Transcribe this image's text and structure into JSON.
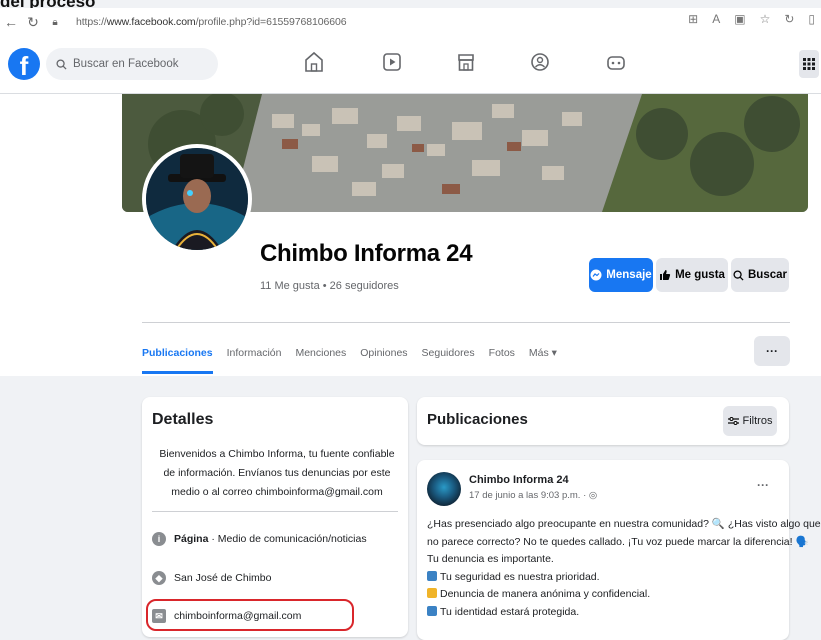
{
  "caption": "del proceso",
  "browser": {
    "url_prefix": "https://",
    "url_domain": "www.facebook.com",
    "url_path": "/profile.php?id=61559768106606"
  },
  "fb": {
    "search_placeholder": "Buscar en Facebook"
  },
  "profile": {
    "name": "Chimbo Informa 24",
    "stats": "11 Me gusta • 26 seguidores",
    "buttons": {
      "message": "Mensaje",
      "like": "Me gusta",
      "search": "Buscar"
    },
    "tabs": [
      "Publicaciones",
      "Información",
      "Menciones",
      "Opiniones",
      "Seguidores",
      "Fotos",
      "Más ▾"
    ],
    "more": "···"
  },
  "details": {
    "title": "Detalles",
    "bio": "Bienvenidos a Chimbo Informa, tu fuente confiable de información. Envíanos tus denuncias por este medio o al correo chimboinforma@gmail.com",
    "category_label": "Página",
    "category_value": " · Medio de comunicación/noticias",
    "location": "San José de Chimbo",
    "email": "chimboinforma@gmail.com"
  },
  "publications": {
    "title": "Publicaciones",
    "filters": "Filtros",
    "post": {
      "author": "Chimbo Informa 24",
      "time": "17 de junio a las 9:03 p.m. · ",
      "lines": [
        "¿Has presenciado algo preocupante en nuestra comunidad? 🔍 ¿Has visto algo que",
        "no parece correcto? No te quedes callado. ¡Tu voz puede marcar la diferencia! 🗣️",
        "Tu denuncia es importante.",
        "Tu seguridad es nuestra prioridad.",
        "Denuncia de manera anónima y confidencial.",
        "Tu identidad estará protegida."
      ]
    }
  },
  "colors": {
    "fb_blue": "#1877f2",
    "highlight_red": "#d9262b"
  }
}
